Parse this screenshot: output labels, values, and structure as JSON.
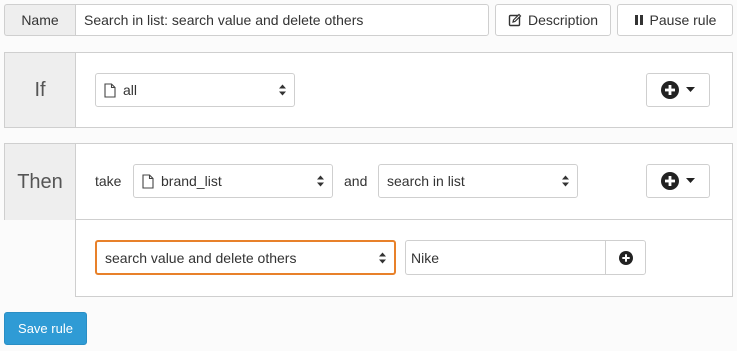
{
  "rule": {
    "name_label": "Name",
    "name_value": "Search in list: search value and delete others",
    "description_label": "Description",
    "pause_label": "Pause rule"
  },
  "if_block": {
    "heading": "If",
    "condition_value": "all"
  },
  "then_block": {
    "heading": "Then",
    "take_word": "take",
    "list_value": "brand_list",
    "and_word": "and",
    "operation_value": "search in list",
    "action_value": "search value and delete others",
    "search_value": "Nike"
  },
  "footer": {
    "save_label": "Save rule"
  },
  "colors": {
    "primary": "#2f9bd5",
    "highlight_border": "#e8812a",
    "panel_header": "#eeeeee"
  }
}
